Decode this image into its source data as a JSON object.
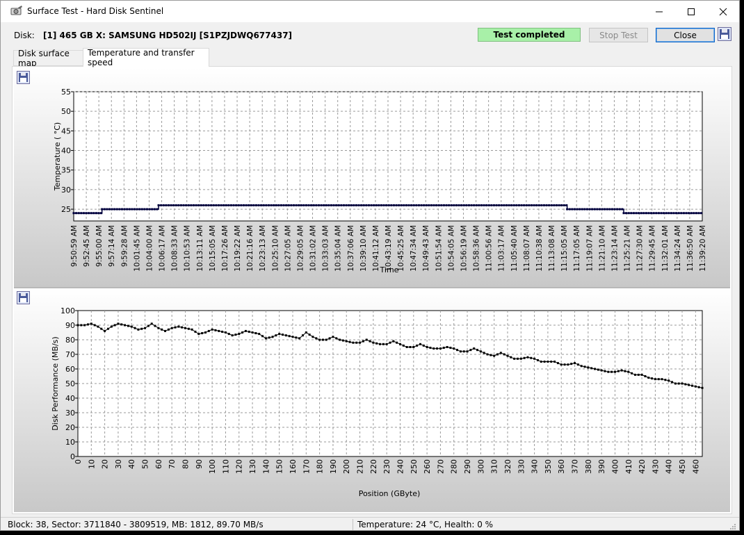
{
  "window": {
    "title": "Surface Test - Hard Disk Sentinel"
  },
  "disk": {
    "label": "Disk:",
    "value": "[1] 465 GB X: SAMSUNG HD502IJ [S1PZJDWQ677437]"
  },
  "status": {
    "text": "Test completed",
    "color": "#a8f0a8"
  },
  "buttons": {
    "stop": "Stop Test",
    "close": "Close"
  },
  "tabs": [
    {
      "label": "Disk surface map",
      "active": false
    },
    {
      "label": "Temperature and transfer speed",
      "active": true
    }
  ],
  "statusbar": {
    "block_info": "Block: 38, Sector: 3711840 - 3809519, MB: 1812, 89.70 MB/s",
    "temp_health": "Temperature: 24  °C,  Health: 0 %"
  },
  "chart_data": [
    {
      "type": "line",
      "ylabel": "Temperature ( °C)",
      "xlabel": "Time",
      "ylim": [
        22,
        55
      ],
      "yticks": [
        25,
        30,
        35,
        40,
        45,
        50,
        55
      ],
      "xticks": [
        "9:50:59 AM",
        "9:52:45 AM",
        "9:55:00 AM",
        "9:57:14 AM",
        "9:59:28 AM",
        "10:01:45 AM",
        "10:04:00 AM",
        "10:06:17 AM",
        "10:08:33 AM",
        "10:10:53 AM",
        "10:13:11 AM",
        "10:15:05 AM",
        "10:17:26 AM",
        "10:19:22 AM",
        "10:21:16 AM",
        "10:23:13 AM",
        "10:25:10 AM",
        "10:27:05 AM",
        "10:29:05 AM",
        "10:31:02 AM",
        "10:33:03 AM",
        "10:35:04 AM",
        "10:37:06 AM",
        "10:39:10 AM",
        "10:41:12 AM",
        "10:43:19 AM",
        "10:45:25 AM",
        "10:47:34 AM",
        "10:49:43 AM",
        "10:51:54 AM",
        "10:54:05 AM",
        "10:56:19 AM",
        "10:58:36 AM",
        "11:00:56 AM",
        "11:03:17 AM",
        "11:05:40 AM",
        "11:08:07 AM",
        "11:10:38 AM",
        "11:13:08 AM",
        "11:15:05 AM",
        "11:17:05 AM",
        "11:19:07 AM",
        "11:21:10 AM",
        "11:23:14 AM",
        "11:25:21 AM",
        "11:27:30 AM",
        "11:29:45 AM",
        "11:32:01 AM",
        "11:34:24 AM",
        "11:36:50 AM",
        "11:39:20 AM"
      ],
      "segments": [
        {
          "from": 0,
          "to": 4.5,
          "value": 24
        },
        {
          "from": 4.5,
          "to": 13.5,
          "value": 25
        },
        {
          "from": 13.5,
          "to": 78.5,
          "value": 26
        },
        {
          "from": 78.5,
          "to": 87.5,
          "value": 25
        },
        {
          "from": 87.5,
          "to": 100,
          "value": 24
        }
      ],
      "grid": true,
      "line_color": "#00003c"
    },
    {
      "type": "line",
      "ylabel": "Disk Performance (MB/s)",
      "xlabel": "Position (GByte)",
      "xlim": [
        0,
        465
      ],
      "ylim": [
        0,
        100
      ],
      "yticks": [
        0,
        10,
        20,
        30,
        40,
        50,
        60,
        70,
        80,
        90,
        100
      ],
      "xticks": [
        0,
        10,
        20,
        30,
        40,
        50,
        60,
        70,
        80,
        90,
        100,
        110,
        120,
        130,
        140,
        150,
        160,
        170,
        180,
        190,
        200,
        210,
        220,
        230,
        240,
        250,
        260,
        270,
        280,
        290,
        300,
        310,
        320,
        330,
        340,
        350,
        360,
        370,
        380,
        390,
        400,
        410,
        420,
        430,
        440,
        450,
        460
      ],
      "anchors": [
        [
          0,
          90
        ],
        [
          5,
          90
        ],
        [
          10,
          91
        ],
        [
          15,
          89
        ],
        [
          20,
          86
        ],
        [
          25,
          89
        ],
        [
          30,
          91
        ],
        [
          35,
          90
        ],
        [
          40,
          89
        ],
        [
          45,
          87
        ],
        [
          50,
          88
        ],
        [
          55,
          91
        ],
        [
          60,
          88
        ],
        [
          65,
          86
        ],
        [
          70,
          88
        ],
        [
          75,
          89
        ],
        [
          80,
          88
        ],
        [
          85,
          87
        ],
        [
          90,
          84
        ],
        [
          95,
          85
        ],
        [
          100,
          87
        ],
        [
          105,
          86
        ],
        [
          110,
          85
        ],
        [
          115,
          83
        ],
        [
          120,
          84
        ],
        [
          125,
          86
        ],
        [
          130,
          85
        ],
        [
          135,
          84
        ],
        [
          140,
          81
        ],
        [
          145,
          82
        ],
        [
          150,
          84
        ],
        [
          155,
          83
        ],
        [
          160,
          82
        ],
        [
          165,
          81
        ],
        [
          170,
          85
        ],
        [
          175,
          82
        ],
        [
          180,
          80
        ],
        [
          185,
          80
        ],
        [
          190,
          82
        ],
        [
          195,
          80
        ],
        [
          200,
          79
        ],
        [
          205,
          78
        ],
        [
          210,
          78
        ],
        [
          215,
          80
        ],
        [
          220,
          78
        ],
        [
          225,
          77
        ],
        [
          230,
          77
        ],
        [
          235,
          79
        ],
        [
          240,
          77
        ],
        [
          245,
          75
        ],
        [
          250,
          75
        ],
        [
          255,
          77
        ],
        [
          260,
          75
        ],
        [
          265,
          74
        ],
        [
          270,
          74
        ],
        [
          275,
          75
        ],
        [
          280,
          74
        ],
        [
          285,
          72
        ],
        [
          290,
          72
        ],
        [
          295,
          74
        ],
        [
          300,
          72
        ],
        [
          305,
          70
        ],
        [
          310,
          69
        ],
        [
          315,
          71
        ],
        [
          320,
          69
        ],
        [
          325,
          67
        ],
        [
          330,
          67
        ],
        [
          335,
          68
        ],
        [
          340,
          67
        ],
        [
          345,
          65
        ],
        [
          350,
          65
        ],
        [
          355,
          65
        ],
        [
          360,
          63
        ],
        [
          365,
          63
        ],
        [
          370,
          64
        ],
        [
          375,
          62
        ],
        [
          380,
          61
        ],
        [
          385,
          60
        ],
        [
          390,
          59
        ],
        [
          395,
          58
        ],
        [
          400,
          58
        ],
        [
          405,
          59
        ],
        [
          410,
          58
        ],
        [
          415,
          56
        ],
        [
          420,
          56
        ],
        [
          425,
          54
        ],
        [
          430,
          53
        ],
        [
          435,
          53
        ],
        [
          440,
          52
        ],
        [
          445,
          50
        ],
        [
          450,
          50
        ],
        [
          455,
          49
        ],
        [
          460,
          48
        ],
        [
          465,
          47
        ]
      ],
      "grid": true,
      "line_color": "#000000"
    }
  ]
}
